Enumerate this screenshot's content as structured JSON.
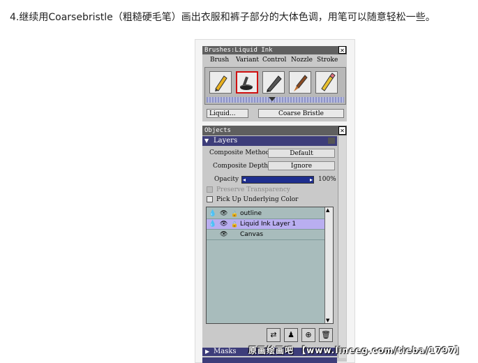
{
  "instruction": "4.继续用Coarsebristle（粗糙硬毛笔）画出衣服和裤子部分的大体色调，用笔可以随意轻松一些。",
  "brushes_panel": {
    "title": "Brushes:Liquid Ink",
    "menu": [
      "Brush",
      "Variant",
      "Control",
      "Nozzle",
      "Stroke"
    ],
    "brush_icons": [
      "pencil-icon",
      "liquid-ink-icon",
      "pen-nib-icon",
      "oil-brush-icon",
      "eraser-pencil-icon"
    ],
    "selected_brush": "liquid-ink-icon",
    "category_value": "Liquid...",
    "variant_value": "Coarse Bristle"
  },
  "objects_panel": {
    "title": "Objects",
    "section": "Layers",
    "composite_method_label": "Composite Method",
    "composite_method_value": "Default",
    "composite_depth_label": "Composite Depth",
    "composite_depth_value": "Ignore",
    "opacity_label": "Opacity",
    "opacity_value": "100%",
    "opacity_level": 1.0,
    "preserve_transparency_label": "Preserve Transparency",
    "pick_up_label": "Pick Up Underlying Color",
    "layers": [
      {
        "name": "outline",
        "selected": false
      },
      {
        "name": "Liquid Ink Layer 1",
        "selected": true
      },
      {
        "name": "Canvas",
        "selected": false
      }
    ],
    "masks_label": "Masks"
  },
  "watermark": "原画绘画吧 【www.lineeg.com/tieba/1797】",
  "colors": {
    "selection": "#b9aef0",
    "title_bar": "#5f5f5f",
    "section_header": "#3d3d7a",
    "list_bg": "#a8bcbc",
    "highlight": "#d01010"
  }
}
